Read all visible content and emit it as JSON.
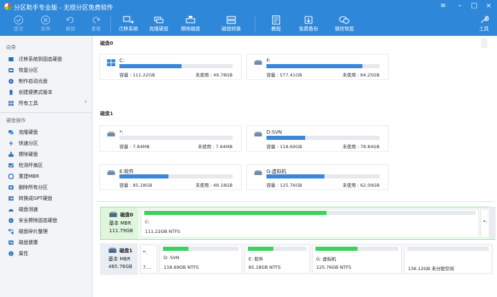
{
  "app": {
    "title": "分区助手专业版 - 无损分区免费软件"
  },
  "window_controls": {
    "menu": "≡",
    "minimize": "–",
    "maximize": "□",
    "close": "×"
  },
  "toolbar": {
    "items": [
      {
        "label": "提交",
        "icon": "check-icon",
        "disabled": true
      },
      {
        "label": "放弃",
        "icon": "cancel-icon",
        "disabled": true
      },
      {
        "label": "撤销",
        "icon": "undo-icon",
        "disabled": true
      },
      {
        "label": "重做",
        "icon": "redo-icon",
        "disabled": true
      },
      {
        "label": "迁移系统",
        "icon": "migrate-icon",
        "disabled": false
      },
      {
        "label": "克隆硬盘",
        "icon": "clone-icon",
        "disabled": false
      },
      {
        "label": "擦除磁盘",
        "icon": "wipe-icon",
        "disabled": false
      },
      {
        "label": "磁盘转换",
        "icon": "convert-icon",
        "disabled": false
      },
      {
        "label": "教程",
        "icon": "tutorial-icon",
        "disabled": false
      },
      {
        "label": "免费备份",
        "icon": "backup-icon",
        "disabled": false
      },
      {
        "label": "微信恢复",
        "icon": "wechat-icon",
        "disabled": false
      },
      {
        "label": "工具",
        "icon": "tools-icon",
        "disabled": false
      }
    ]
  },
  "sidebar": {
    "wizard_title": "向导",
    "wizard_items": [
      {
        "label": "迁移系统到固态硬盘",
        "icon": "migrate-icon"
      },
      {
        "label": "恢复分区",
        "icon": "recover-icon"
      },
      {
        "label": "制作启动光盘",
        "icon": "bootdisk-icon"
      },
      {
        "label": "创建便携式版本",
        "icon": "portable-icon"
      },
      {
        "label": "所有工具",
        "icon": "alltools-icon",
        "arrow": "›"
      }
    ],
    "disk_ops_title": "硬盘操作",
    "disk_ops_items": [
      {
        "label": "克隆硬盘",
        "icon": "clone-icon"
      },
      {
        "label": "快速分区",
        "icon": "quick-partition-icon"
      },
      {
        "label": "擦除硬盘",
        "icon": "wipe-icon"
      },
      {
        "label": "检测坏扇区",
        "icon": "badsector-icon"
      },
      {
        "label": "重建MBR",
        "icon": "mbr-icon"
      },
      {
        "label": "删除所有分区",
        "icon": "delete-all-icon"
      },
      {
        "label": "转换成GPT硬盘",
        "icon": "gpt-icon"
      },
      {
        "label": "磁盘测速",
        "icon": "speed-icon"
      },
      {
        "label": "安全擦除固态硬盘",
        "icon": "secure-erase-icon"
      },
      {
        "label": "磁盘碎片整理",
        "icon": "defrag-icon"
      },
      {
        "label": "磁盘健康",
        "icon": "health-icon"
      },
      {
        "label": "属性",
        "icon": "info-icon"
      }
    ]
  },
  "disk0": {
    "header": "磁盘0",
    "partitions": [
      {
        "name": "C:",
        "used_fraction": 0.55,
        "capacity_label": "容量 : 111.22GB",
        "free_label": "未使用 : 49.78GB",
        "icon": "windows-icon"
      },
      {
        "name": "F:",
        "used_fraction": 0.85,
        "capacity_label": "容量 : 577.41GB",
        "free_label": "未使用 : 84.25GB",
        "icon": "drive-icon"
      }
    ]
  },
  "disk1": {
    "header": "磁盘1",
    "partitions": [
      {
        "name": "*:",
        "used_fraction": 0.0,
        "capacity_label": "容量 : 7.84MB",
        "free_label": "未使用 : 7.84MB",
        "icon": "drive-icon"
      },
      {
        "name": "D:SVN",
        "used_fraction": 0.34,
        "capacity_label": "容量 : 118.69GB",
        "free_label": "未使用 : 78.84GB",
        "icon": "drive-icon"
      },
      {
        "name": "E:软件",
        "used_fraction": 0.43,
        "capacity_label": "容量 : 85.18GB",
        "free_label": "未使用 : 48.18GB",
        "icon": "drive-icon"
      },
      {
        "name": "G:虚拟机",
        "used_fraction": 0.51,
        "capacity_label": "容量 : 125.76GB",
        "free_label": "未使用 : 62.09GB",
        "icon": "drive-icon"
      }
    ]
  },
  "bottom": {
    "disk0": {
      "name": "磁盘0",
      "type": "基本 MBR",
      "size": "111.79GB",
      "segments": [
        {
          "name": "C:",
          "detail": "111.22GB NTFS",
          "used_fraction": 0.55
        }
      ],
      "tail": "*:"
    },
    "disk1": {
      "name": "磁盘1",
      "type": "基本 MBR",
      "size": "465.76GB",
      "segments": [
        {
          "name": "*:",
          "detail": "7....",
          "used_fraction": 0.0
        },
        {
          "name": "D: SVN",
          "detail": "118.69GB NTFS",
          "used_fraction": 0.34
        },
        {
          "name": "E: 软件",
          "detail": "85.18GB NTFS",
          "used_fraction": 0.43
        },
        {
          "name": "G: 虚拟机",
          "detail": "125.76GB NTFS",
          "used_fraction": 0.51
        },
        {
          "name": "",
          "detail": "136.12GB 未分配空间",
          "used_fraction": 0.0
        }
      ]
    }
  },
  "colors": {
    "titlebar": "#2e87d9",
    "bar_blue": "#3a86d8",
    "bar_green": "#3fd15d",
    "selected_border": "#9fe09f"
  }
}
